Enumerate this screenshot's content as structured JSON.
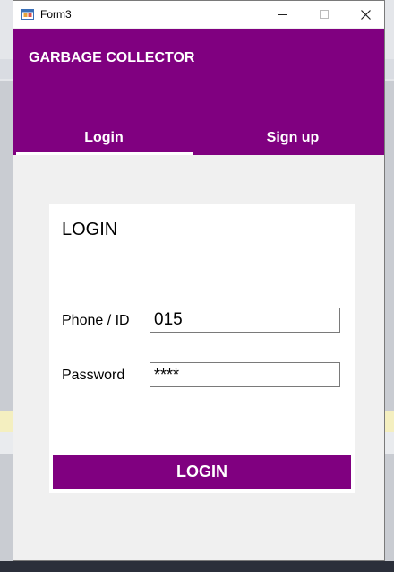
{
  "window": {
    "title": "Form3"
  },
  "app": {
    "title": "GARBAGE COLLECTOR",
    "brand_color": "#800080"
  },
  "tabs": [
    {
      "label": "Login",
      "active": true
    },
    {
      "label": "Sign up",
      "active": false
    }
  ],
  "login_card": {
    "heading": "LOGIN",
    "phone_label": "Phone / ID",
    "phone_value": "015",
    "password_label": "Password",
    "password_value": "****",
    "submit_label": "LOGIN"
  },
  "icons": [
    "app-icon",
    "minimize-icon",
    "maximize-icon",
    "close-icon"
  ]
}
